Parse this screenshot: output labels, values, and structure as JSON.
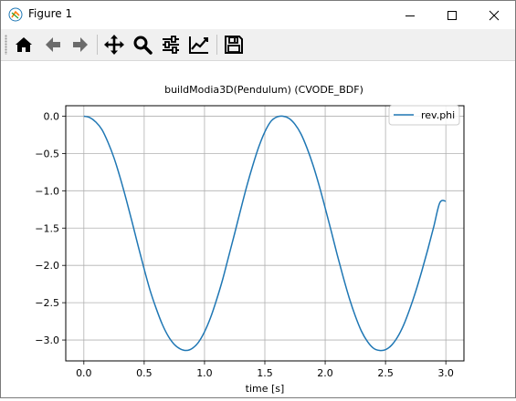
{
  "window": {
    "title": "Figure 1",
    "controls": [
      "minimize",
      "maximize",
      "close"
    ]
  },
  "toolbar": {
    "buttons": [
      {
        "name": "home",
        "icon": "home-icon"
      },
      {
        "name": "back",
        "icon": "arrow-left-icon"
      },
      {
        "name": "forward",
        "icon": "arrow-right-icon"
      },
      {
        "name": "pan",
        "icon": "move-icon"
      },
      {
        "name": "zoom",
        "icon": "zoom-icon"
      },
      {
        "name": "configure-subplots",
        "icon": "sliders-icon"
      },
      {
        "name": "edit-axis",
        "icon": "axis-edit-icon"
      },
      {
        "name": "save",
        "icon": "save-icon"
      }
    ]
  },
  "chart_data": {
    "type": "line",
    "title": "buildModia3D(Pendulum) (CVODE_BDF)",
    "xlabel": "time [s]",
    "ylabel": "",
    "xlim": [
      -0.15,
      3.15
    ],
    "ylim": [
      -3.28,
      0.14
    ],
    "xticks": [
      0.0,
      0.5,
      1.0,
      1.5,
      2.0,
      2.5,
      3.0
    ],
    "xtick_labels": [
      "0.0",
      "0.5",
      "1.0",
      "1.5",
      "2.0",
      "2.5",
      "3.0"
    ],
    "yticks": [
      0.0,
      -0.5,
      -1.0,
      -1.5,
      -2.0,
      -2.5,
      -3.0
    ],
    "ytick_labels": [
      "0.0",
      "−0.5",
      "−1.0",
      "−1.5",
      "−2.0",
      "−2.5",
      "−3.0"
    ],
    "grid": true,
    "legend_position": "top-right",
    "series": [
      {
        "name": "rev.phi",
        "color": "#1f77b4",
        "x": [
          0.0,
          0.05,
          0.1,
          0.15,
          0.2,
          0.25,
          0.3,
          0.35,
          0.4,
          0.45,
          0.5,
          0.55,
          0.6,
          0.65,
          0.7,
          0.75,
          0.8,
          0.85,
          0.9,
          0.95,
          1.0,
          1.05,
          1.1,
          1.15,
          1.2,
          1.25,
          1.3,
          1.35,
          1.4,
          1.45,
          1.5,
          1.55,
          1.6,
          1.65,
          1.7,
          1.75,
          1.8,
          1.85,
          1.9,
          1.95,
          2.0,
          2.05,
          2.1,
          2.15,
          2.2,
          2.25,
          2.3,
          2.35,
          2.4,
          2.45,
          2.5,
          2.55,
          2.6,
          2.65,
          2.7,
          2.75,
          2.8,
          2.85,
          2.9,
          2.95,
          3.0
        ],
        "y": [
          0.0,
          -0.02,
          -0.08,
          -0.18,
          -0.35,
          -0.56,
          -0.82,
          -1.11,
          -1.42,
          -1.74,
          -2.05,
          -2.34,
          -2.58,
          -2.79,
          -2.95,
          -3.06,
          -3.12,
          -3.14,
          -3.11,
          -3.03,
          -2.89,
          -2.7,
          -2.46,
          -2.19,
          -1.88,
          -1.57,
          -1.25,
          -0.94,
          -0.66,
          -0.41,
          -0.21,
          -0.07,
          -0.01,
          0.0,
          -0.03,
          -0.11,
          -0.24,
          -0.43,
          -0.66,
          -0.93,
          -1.23,
          -1.54,
          -1.86,
          -2.16,
          -2.44,
          -2.68,
          -2.88,
          -3.02,
          -3.11,
          -3.14,
          -3.13,
          -3.07,
          -2.96,
          -2.8,
          -2.59,
          -2.35,
          -2.08,
          -1.79,
          -1.48,
          -1.16,
          -1.14
        ]
      }
    ]
  }
}
